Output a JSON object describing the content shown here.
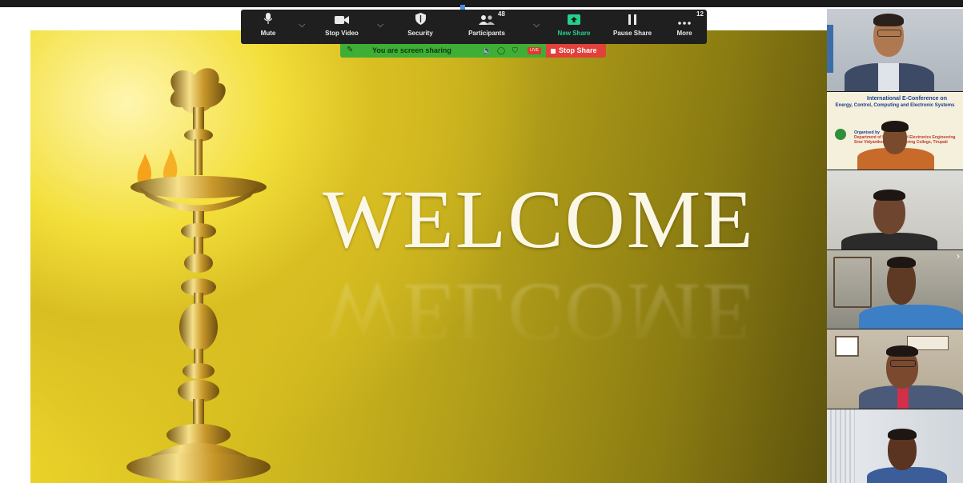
{
  "slide": {
    "heading": "WELCOME",
    "heading_reflection": "WELCOME"
  },
  "toolbar": {
    "buttons": [
      {
        "label": "Mute",
        "icon": "microphone-icon"
      },
      {
        "label": "Stop Video",
        "icon": "video-camera-icon"
      },
      {
        "label": "Security",
        "icon": "shield-icon"
      },
      {
        "label": "Participants",
        "icon": "participants-icon",
        "count": "48"
      },
      {
        "label": "New Share",
        "icon": "share-screen-icon"
      },
      {
        "label": "Pause Share",
        "icon": "pause-icon"
      },
      {
        "label": "More",
        "icon": "more-icon",
        "count": "12"
      }
    ]
  },
  "share_banner": {
    "message": "You are screen sharing",
    "live_badge": "LIVE",
    "stop_label": "Stop Share"
  },
  "conference_tile": {
    "title": "International E-Conference on",
    "subtitle": "Energy, Control, Computing and Electronic Systems",
    "org_label": "Organised by",
    "org_line1": "Department of Electrical and Electronics Engineering",
    "org_line2": "Sree Vidyanikethan Engineering College, Tirupati"
  },
  "colors": {
    "toolbar_bg": "#1f1f1f",
    "share_green": "#3fae36",
    "stop_red": "#e2403a",
    "new_share_green": "#23d18b",
    "slide_gold": "#d9be22"
  }
}
